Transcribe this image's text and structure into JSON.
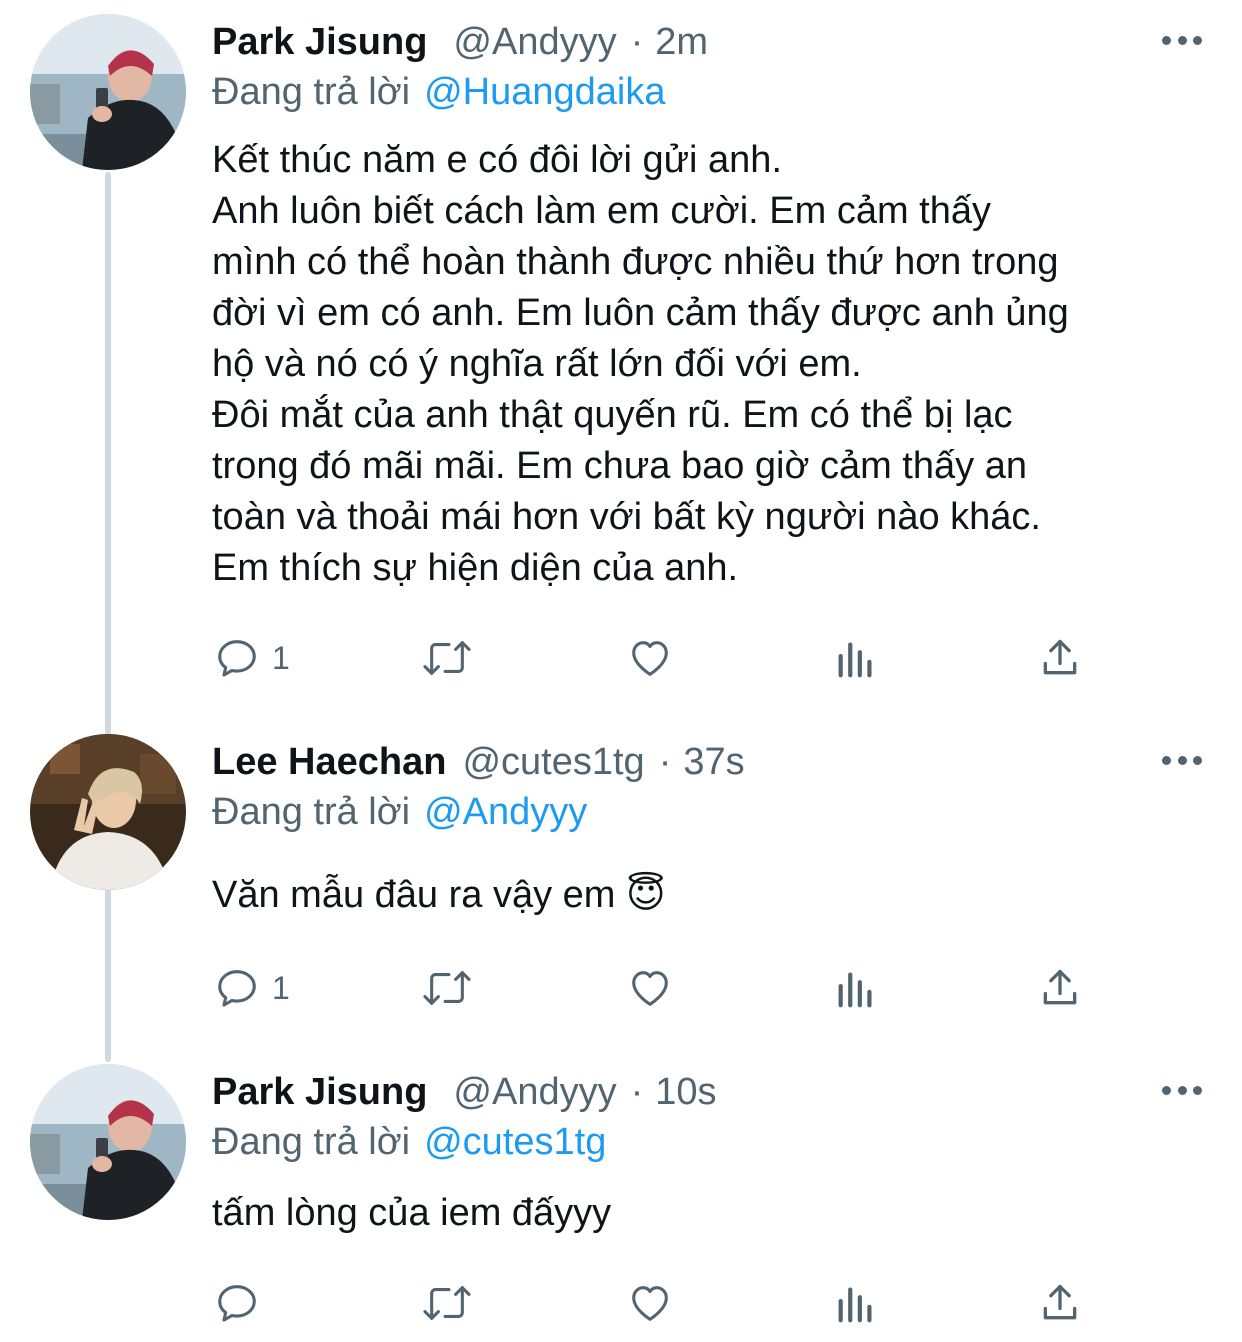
{
  "colors": {
    "accent": "#1d9bf0",
    "secondary_text": "#536471",
    "thread_line": "#cfd9de"
  },
  "tweets": [
    {
      "author_name": "Park Jisung",
      "handle": "@Andyyy",
      "separator": "·",
      "time": "2m",
      "replying_to_label": "Đang trả lời",
      "replying_to_handle": "@Huangdaika",
      "lines": [
        "Kết thúc năm e có đôi lời gửi anh.",
        "Anh luôn biết cách làm em cười. Em cảm thấy",
        "mình có thể hoàn thành được nhiều thứ hơn trong",
        "đời vì em có anh. Em luôn cảm thấy được anh ủng",
        "hộ và nó có ý nghĩa rất lớn đối với em.",
        "Đôi mắt của anh thật quyến rũ. Em có thể bị lạc",
        "trong đó mãi mãi. Em chưa bao giờ cảm thấy an",
        "toàn và thoải mái hơn với bất kỳ người nào khác.",
        "Em thích sự hiện diện của anh."
      ],
      "reply_count": "1",
      "avatar_icon": "avatar-photo"
    },
    {
      "author_name": "Lee Haechan",
      "handle": "@cutes1tg",
      "separator": "·",
      "time": "37s",
      "replying_to_label": "Đang trả lời",
      "replying_to_handle": "@Andyyy",
      "lines": [
        "Văn mẫu đâu ra vậy em 😇"
      ],
      "reply_count": "1",
      "avatar_icon": "avatar-photo"
    },
    {
      "author_name": "Park Jisung",
      "handle": "@Andyyy",
      "separator": "·",
      "time": "10s",
      "replying_to_label": "Đang trả lời",
      "replying_to_handle": "@cutes1tg",
      "lines": [
        "tấm lòng của iem đấyyy"
      ],
      "reply_count": "",
      "avatar_icon": "avatar-photo"
    }
  ],
  "action_icons": [
    "reply-icon",
    "retweet-icon",
    "like-icon",
    "analytics-icon",
    "share-icon"
  ]
}
